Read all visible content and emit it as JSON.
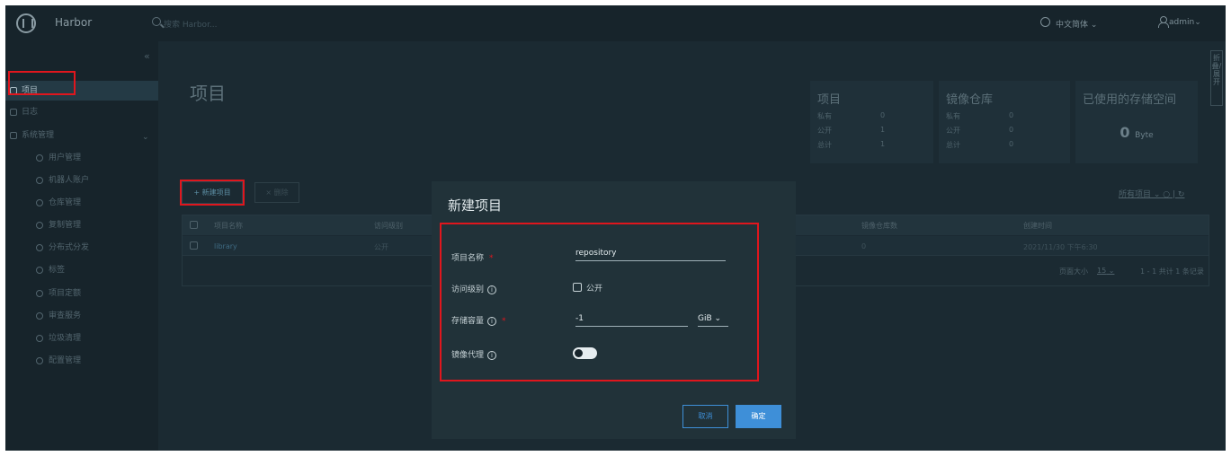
{
  "header": {
    "app_name": "Harbor",
    "search_placeholder": "搜索 Harbor...",
    "language": "中文简体",
    "user": "admin"
  },
  "sidebar": {
    "items": [
      {
        "label": "项目",
        "active": true
      },
      {
        "label": "日志"
      },
      {
        "label": "系统管理"
      },
      {
        "label": "用户管理"
      },
      {
        "label": "机器人账户"
      },
      {
        "label": "仓库管理"
      },
      {
        "label": "复制管理"
      },
      {
        "label": "分布式分发"
      },
      {
        "label": "标签"
      },
      {
        "label": "项目定额"
      },
      {
        "label": "审查服务"
      },
      {
        "label": "垃圾清理"
      },
      {
        "label": "配置管理"
      }
    ]
  },
  "main": {
    "title": "项目",
    "stats": {
      "projects": {
        "title": "项目",
        "rows": [
          {
            "label": "私有",
            "value": "0"
          },
          {
            "label": "公开",
            "value": "1"
          },
          {
            "label": "总计",
            "value": "1"
          }
        ]
      },
      "repos": {
        "title": "镜像仓库",
        "rows": [
          {
            "label": "私有",
            "value": "0"
          },
          {
            "label": "公开",
            "value": "0"
          },
          {
            "label": "总计",
            "value": "0"
          }
        ]
      },
      "storage": {
        "title": "已使用的存储空间",
        "value": "0",
        "unit": "Byte"
      }
    },
    "new_project_button": "+ 新建项目",
    "delete_button": "× 删除",
    "filter_label": "所有项目",
    "table": {
      "columns": [
        "项目名称",
        "访问级别",
        "镜像仓库数",
        "创建时间"
      ],
      "rows": [
        {
          "name": "library",
          "access": "公开",
          "repo_count": "0",
          "created": "2021/11/30 下午6:30"
        }
      ],
      "page_size_label": "页面大小",
      "page_size": "15",
      "summary": "1 - 1 共计 1 条记录"
    },
    "side_tab": "折叠/展开"
  },
  "modal": {
    "title": "新建项目",
    "fields": {
      "name_label": "项目名称",
      "name_value": "repository",
      "access_label": "访问级别",
      "public_label": "公开",
      "quota_label": "存储容量",
      "quota_value": "-1",
      "quota_unit": "GiB",
      "proxy_label": "镜像代理"
    },
    "cancel": "取消",
    "ok": "确定"
  },
  "colors": {
    "accent": "#3e8fd8",
    "highlight": "#e0161d",
    "background": "#1b2a32"
  }
}
